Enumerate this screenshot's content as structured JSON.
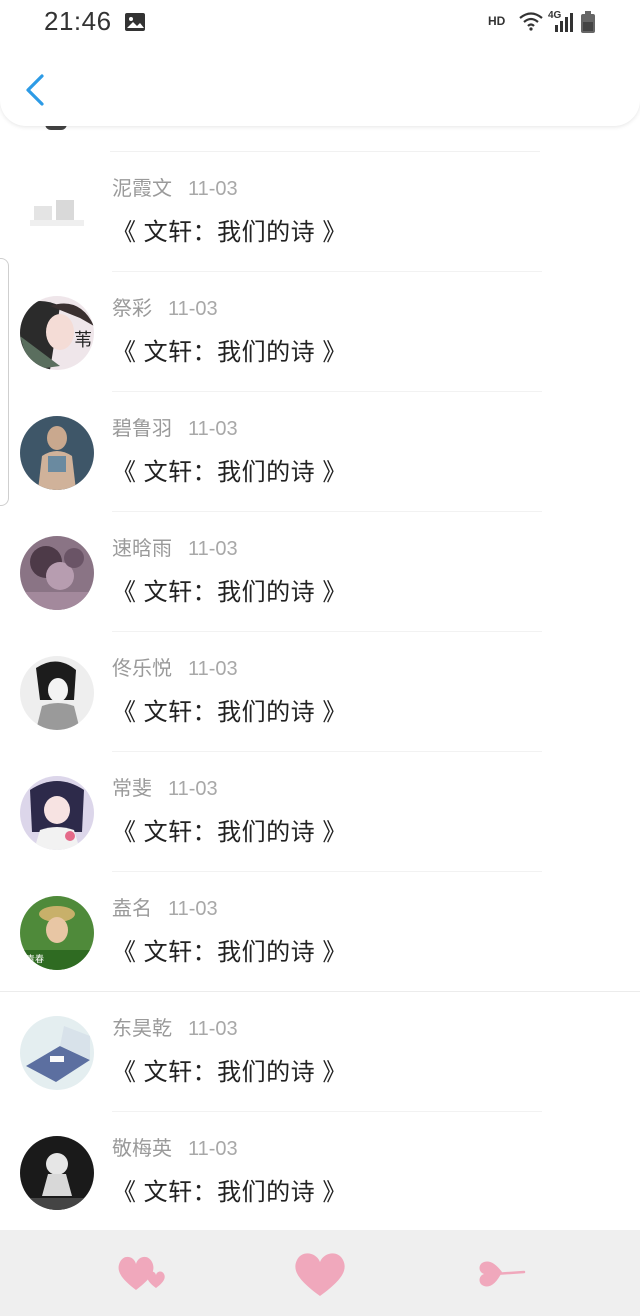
{
  "status_bar": {
    "time": "21:46",
    "hd": "HD",
    "network": "4G"
  },
  "list": [
    {
      "name": "泥霞文",
      "date": "11-03",
      "title": "《 文轩：我们的诗 》"
    },
    {
      "name": "祭彩",
      "date": "11-03",
      "title": "《 文轩：我们的诗 》"
    },
    {
      "name": "碧鲁羽",
      "date": "11-03",
      "title": "《 文轩：我们的诗 》"
    },
    {
      "name": "速晗雨",
      "date": "11-03",
      "title": "《 文轩：我们的诗 》"
    },
    {
      "name": "佟乐悦",
      "date": "11-03",
      "title": "《 文轩：我们的诗 》"
    },
    {
      "name": "常斐",
      "date": "11-03",
      "title": "《 文轩：我们的诗 》"
    },
    {
      "name": "盍名",
      "date": "11-03",
      "title": "《 文轩：我们的诗 》"
    },
    {
      "name": "东昊乾",
      "date": "11-03",
      "title": "《 文轩：我们的诗 》"
    },
    {
      "name": "敬梅英",
      "date": "11-03",
      "title": "《 文轩：我们的诗 》"
    }
  ],
  "colors": {
    "accent_blue": "#2d9be6",
    "heart_pink": "#f0a8bc"
  },
  "icons": {
    "back": "chevron-left-icon",
    "like": "double-heart-icon",
    "favorite": "heart-icon",
    "share": "heart-arrow-icon"
  }
}
